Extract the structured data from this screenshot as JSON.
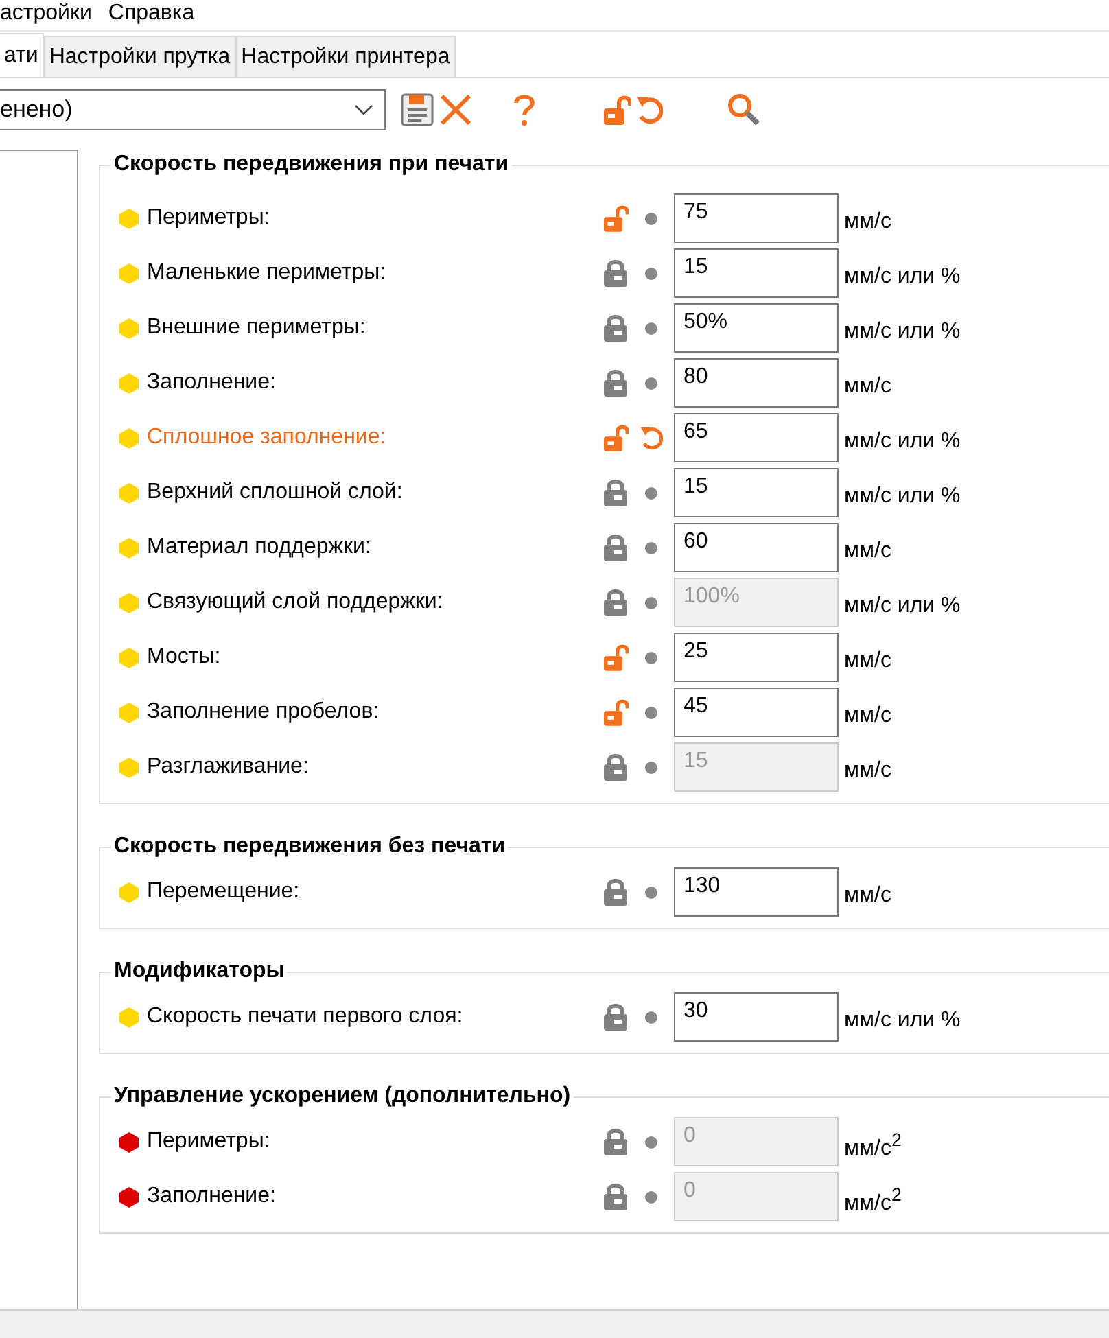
{
  "menu": [
    {
      "label": "астройки"
    },
    {
      "label": "Справка"
    }
  ],
  "tabs": [
    {
      "label": "ати",
      "selected": true
    },
    {
      "label": "Настройки прутка",
      "selected": false
    },
    {
      "label": "Настройки принтера",
      "selected": false
    }
  ],
  "preset": {
    "value": "енено)"
  },
  "sections": [
    {
      "title": "Скорость передвижения при печати",
      "rows": [
        {
          "label": "Периметры:",
          "color": "#ffd700",
          "modified": false,
          "locked": false,
          "value": "75",
          "disabled": false,
          "unit": "мм/с"
        },
        {
          "label": "Маленькие периметры:",
          "color": "#ffd700",
          "modified": false,
          "locked": true,
          "value": "15",
          "disabled": false,
          "unit": "мм/с или %"
        },
        {
          "label": "Внешние периметры:",
          "color": "#ffd700",
          "modified": false,
          "locked": true,
          "value": "50%",
          "disabled": false,
          "unit": "мм/с или %"
        },
        {
          "label": "Заполнение:",
          "color": "#ffd700",
          "modified": false,
          "locked": true,
          "value": "80",
          "disabled": false,
          "unit": "мм/с"
        },
        {
          "label": "Сплошное заполнение:",
          "color": "#ffd700",
          "modified": true,
          "locked": false,
          "value": "65",
          "disabled": false,
          "unit": "мм/с или %"
        },
        {
          "label": "Верхний сплошной слой:",
          "color": "#ffd700",
          "modified": false,
          "locked": true,
          "value": "15",
          "disabled": false,
          "unit": "мм/с или %"
        },
        {
          "label": "Материал поддержки:",
          "color": "#ffd700",
          "modified": false,
          "locked": true,
          "value": "60",
          "disabled": false,
          "unit": "мм/с"
        },
        {
          "label": "Связующий слой поддержки:",
          "color": "#ffd700",
          "modified": false,
          "locked": true,
          "value": "100%",
          "disabled": true,
          "unit": "мм/с или %"
        },
        {
          "label": "Мосты:",
          "color": "#ffd700",
          "modified": false,
          "locked": false,
          "value": "25",
          "disabled": false,
          "unit": "мм/с"
        },
        {
          "label": "Заполнение пробелов:",
          "color": "#ffd700",
          "modified": false,
          "locked": false,
          "value": "45",
          "disabled": false,
          "unit": "мм/с"
        },
        {
          "label": "Разглаживание:",
          "color": "#ffd700",
          "modified": false,
          "locked": true,
          "value": "15",
          "disabled": true,
          "unit": "мм/с"
        }
      ]
    },
    {
      "title": "Скорость передвижения без печати",
      "rows": [
        {
          "label": "Перемещение:",
          "color": "#ffd700",
          "modified": false,
          "locked": true,
          "value": "130",
          "disabled": false,
          "unit": "мм/с"
        }
      ]
    },
    {
      "title": "Модификаторы",
      "rows": [
        {
          "label": "Скорость печати первого слоя:",
          "color": "#ffd700",
          "modified": false,
          "locked": true,
          "value": "30",
          "disabled": false,
          "unit": "мм/с или %"
        }
      ]
    },
    {
      "title": "Управление ускорением (дополнительно)",
      "rows": [
        {
          "label": "Периметры:",
          "color": "#dd0000",
          "modified": false,
          "locked": true,
          "value": "0",
          "disabled": true,
          "unit": "мм/с$^{2}$"
        },
        {
          "label": "Заполнение:",
          "color": "#dd0000",
          "modified": false,
          "locked": true,
          "value": "0",
          "disabled": true,
          "unit": "мм/с$^{2}$"
        }
      ]
    }
  ]
}
